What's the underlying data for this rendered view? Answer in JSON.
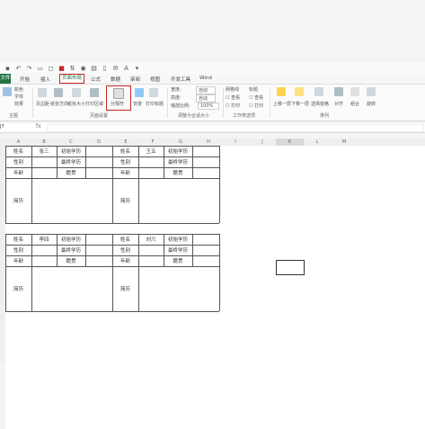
{
  "tabs": {
    "file": "文件",
    "items": [
      "开始",
      "插入",
      "页面布局",
      "公式",
      "数据",
      "审阅",
      "视图",
      "开发工具",
      "Wind"
    ]
  },
  "ribbon": {
    "theme": {
      "colors": "颜色",
      "fonts": "字体",
      "effects": "效果",
      "group": "主题"
    },
    "page_setup": {
      "margins": "页边距",
      "orientation": "纸张方向",
      "size": "纸张大小",
      "print_area": "打印区域",
      "breaks": "分隔符",
      "background": "背景",
      "print_titles": "打印标题",
      "group": "页面设置"
    },
    "scale": {
      "width_label": "宽度:",
      "width_val": "自动",
      "height_label": "高度:",
      "height_val": "自动",
      "scale_label": "缩放比例:",
      "scale_val": "100%",
      "group": "调整为合适大小"
    },
    "sheet_options": {
      "gridlines": "网格线",
      "headings": "标题",
      "view1": "查看",
      "view2": "查看",
      "print1": "打印",
      "print2": "打印",
      "group": "工作表选项"
    },
    "arrange": {
      "forward": "上移一层",
      "backward": "下移一层",
      "selection_pane": "选择窗格",
      "align": "对齐",
      "group_btn": "组合",
      "rotate": "旋转",
      "group": "排列"
    }
  },
  "name_box": "J7",
  "columns": [
    "A",
    "B",
    "C",
    "D",
    "E",
    "F",
    "G",
    "H",
    "I",
    "J",
    "K",
    "L",
    "M"
  ],
  "tables": [
    {
      "r1": [
        "姓名",
        "张三",
        "初始学历",
        ""
      ],
      "r2": [
        "性别",
        "",
        "最终学历",
        ""
      ],
      "r3": [
        "年龄",
        "",
        "籍贯",
        ""
      ],
      "r4": [
        "简历"
      ]
    },
    {
      "r1": [
        "姓名",
        "王五",
        "初始学历",
        ""
      ],
      "r2": [
        "性别",
        "",
        "最终学历",
        ""
      ],
      "r3": [
        "年龄",
        "",
        "籍贯",
        ""
      ],
      "r4": [
        "简历"
      ]
    },
    {
      "r1": [
        "姓名",
        "李四",
        "初始学历",
        ""
      ],
      "r2": [
        "性别",
        "",
        "最终学历",
        ""
      ],
      "r3": [
        "年龄",
        "",
        "籍贯",
        ""
      ],
      "r4": [
        "简历"
      ]
    },
    {
      "r1": [
        "姓名",
        "刘六",
        "初始学历",
        ""
      ],
      "r2": [
        "性别",
        "",
        "最终学历",
        ""
      ],
      "r3": [
        "年龄",
        "",
        "籍贯",
        ""
      ],
      "r4": [
        "简历"
      ]
    }
  ]
}
